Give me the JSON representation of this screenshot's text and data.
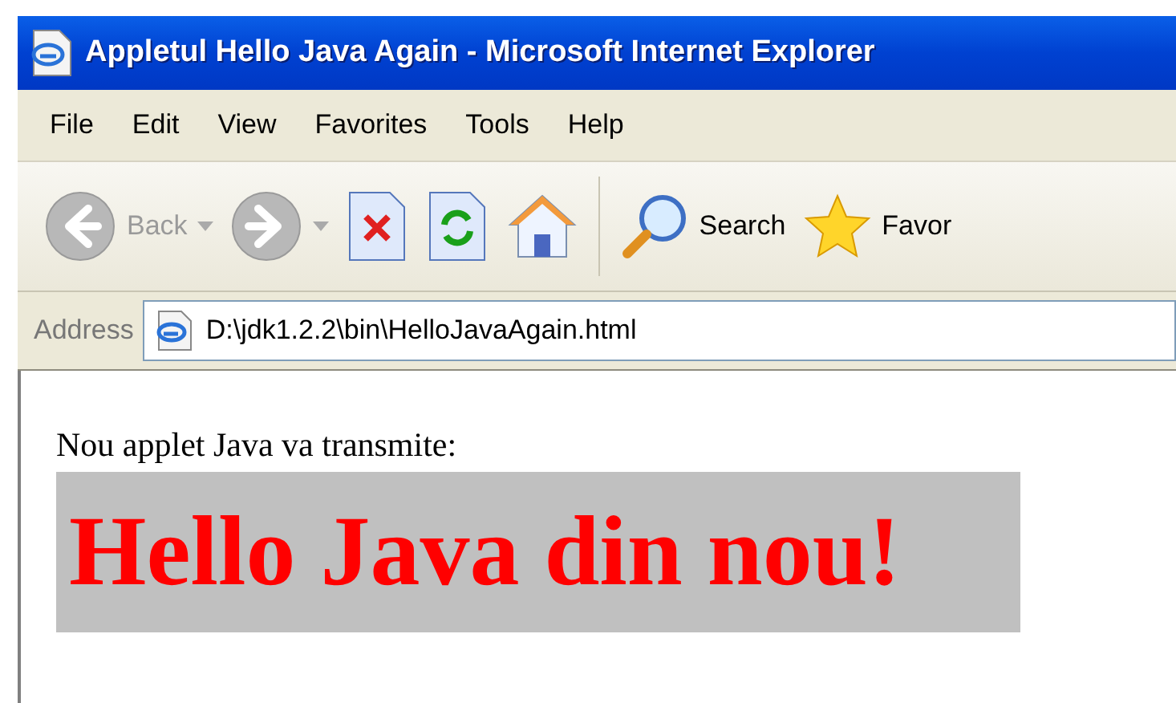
{
  "window": {
    "title": "Appletul Hello Java Again - Microsoft Internet Explorer"
  },
  "menu": [
    "File",
    "Edit",
    "View",
    "Favorites",
    "Tools",
    "Help"
  ],
  "toolbar": [
    {
      "kind": "back",
      "label": "Back",
      "disabled": true
    },
    {
      "kind": "forward",
      "disabled": true
    },
    {
      "kind": "stop",
      "disabled": false
    },
    {
      "kind": "refresh",
      "disabled": false
    },
    {
      "kind": "home",
      "disabled": false
    },
    {
      "kind": "search",
      "label": "Search",
      "disabled": false
    },
    {
      "kind": "favorites",
      "label": "Favor",
      "disabled": false
    }
  ],
  "address": {
    "label": "Address",
    "value": "D:\\jdk1.2.2\\bin\\HelloJavaAgain.html"
  },
  "page": {
    "intro": "Nou applet Java va transmite:",
    "applet_text": "Hello Java din nou!"
  }
}
